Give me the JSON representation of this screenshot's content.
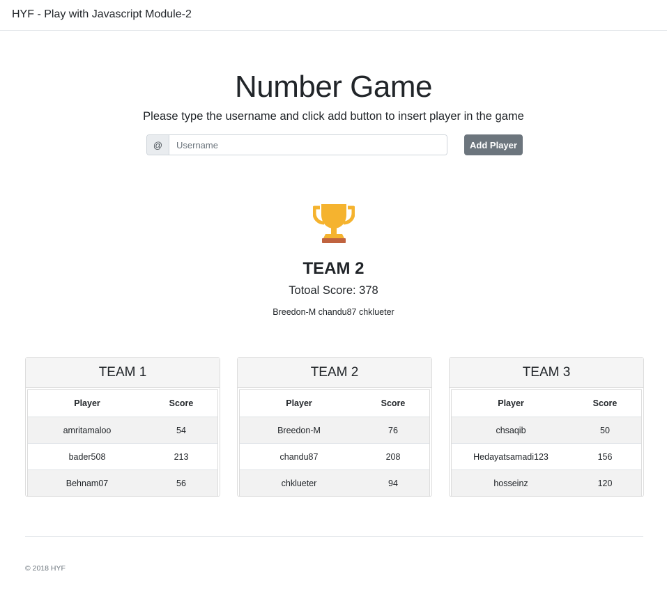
{
  "navbar": {
    "brand": "HYF - Play with Javascript Module-2"
  },
  "hero": {
    "title": "Number Game",
    "subtitle": "Please type the username and click add button to insert player in the game",
    "input_prefix": "@",
    "input_placeholder": "Username",
    "input_value": "",
    "add_button_label": "Add Player"
  },
  "winner": {
    "icon": "trophy-icon",
    "team_name": "TEAM 2",
    "score_text": "Totoal Score: 378",
    "players_text": "Breedon-M chandu87 chklueter"
  },
  "teams": [
    {
      "name": "TEAM 1",
      "columns": [
        "Player",
        "Score"
      ],
      "rows": [
        {
          "player": "amritamaloo",
          "score": "54"
        },
        {
          "player": "bader508",
          "score": "213"
        },
        {
          "player": "Behnam07",
          "score": "56"
        }
      ]
    },
    {
      "name": "TEAM 2",
      "columns": [
        "Player",
        "Score"
      ],
      "rows": [
        {
          "player": "Breedon-M",
          "score": "76"
        },
        {
          "player": "chandu87",
          "score": "208"
        },
        {
          "player": "chklueter",
          "score": "94"
        }
      ]
    },
    {
      "name": "TEAM 3",
      "columns": [
        "Player",
        "Score"
      ],
      "rows": [
        {
          "player": "chsaqib",
          "score": "50"
        },
        {
          "player": "Hedayatsamadi123",
          "score": "156"
        },
        {
          "player": "hosseinz",
          "score": "120"
        }
      ]
    }
  ],
  "footer": {
    "copyright": "© 2018 HYF"
  },
  "colors": {
    "button_bg": "#6c757d",
    "card_header_bg": "#f5f5f5",
    "stripe_bg": "#f2f2f2",
    "trophy_gold": "#f5b32f",
    "trophy_base": "#c0633f"
  }
}
